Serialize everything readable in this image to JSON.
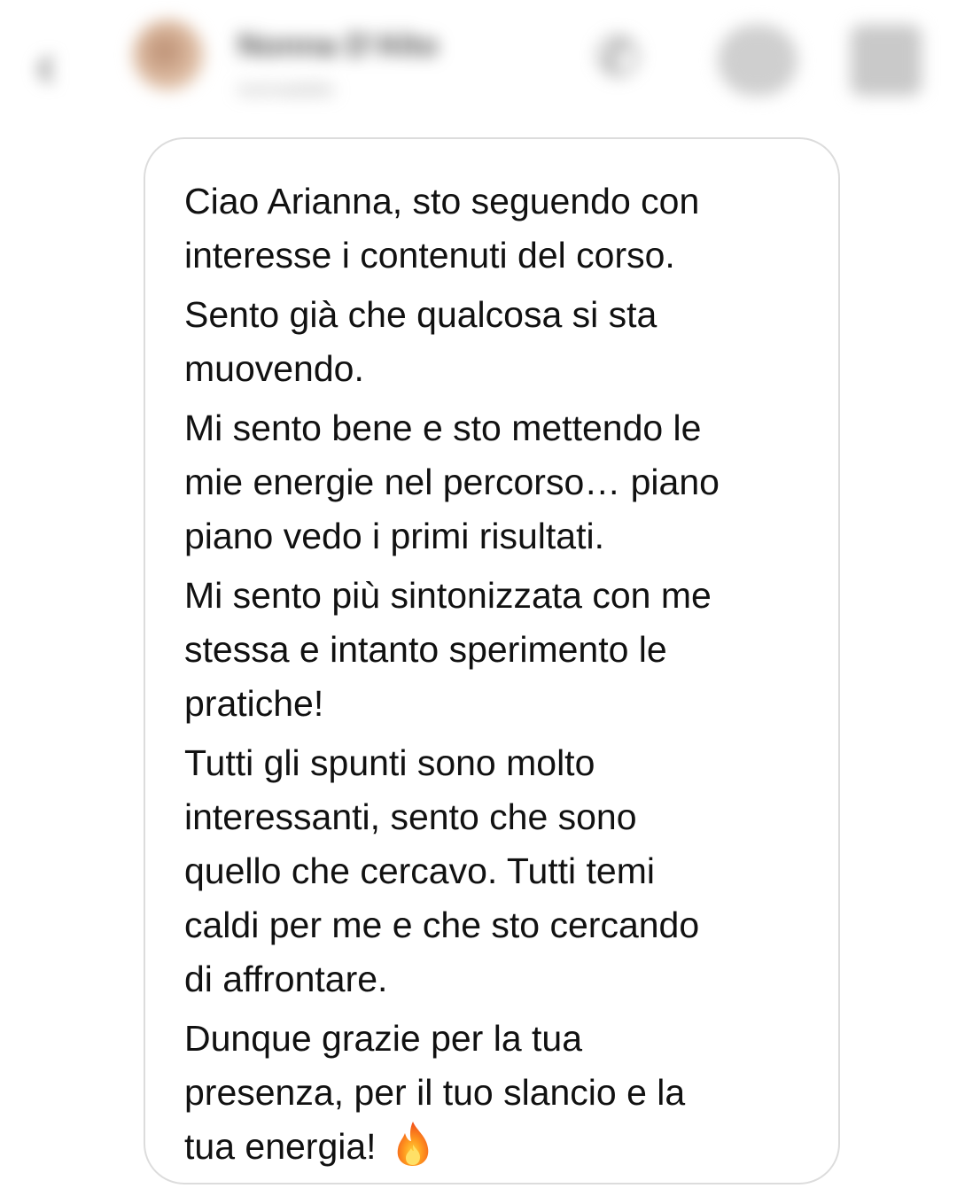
{
  "header": {
    "contact_name": "Nonna D'Alto",
    "contact_sub": "nonnadalto",
    "icons": [
      "back-icon",
      "avatar",
      "phone-icon",
      "video-icon",
      "info-icon"
    ]
  },
  "message": {
    "paragraphs": [
      "Ciao Arianna, sto seguendo con\ninteresse i contenuti del corso.",
      "Sento già che qualcosa si sta\nmuovendo.",
      "Mi sento bene e sto mettendo le\nmie energie nel percorso… piano\npiano vedo i primi risultati.",
      "Mi sento più sintonizzata con me\nstessa e intanto sperimento le\npratiche!",
      "Tutti gli spunti sono molto\ninteressanti, sento che sono\nquello che cercavo. Tutti temi\ncaldi per me e che sto cercando\ndi affrontare.",
      "Dunque grazie per la tua\npresenza, per il tuo slancio e la\ntua energia!"
    ],
    "trailing_emoji": "fire-icon"
  },
  "colors": {
    "bubble_border": "#dcdcdc",
    "text": "#111111",
    "background": "#ffffff"
  }
}
